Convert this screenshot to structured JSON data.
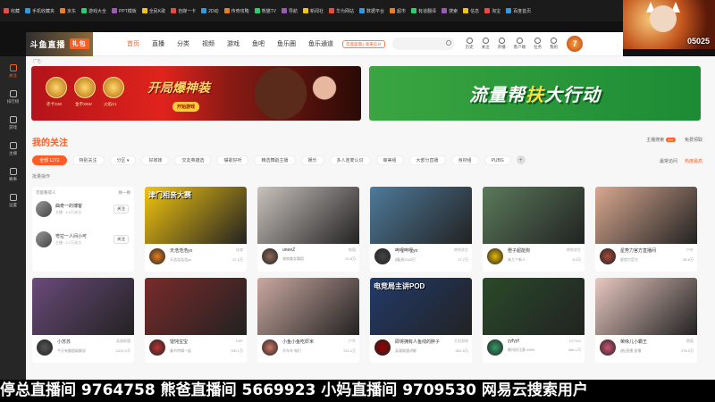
{
  "bookmarks": [
    "收藏",
    "手机收藏夹",
    "京东",
    "游戏大全",
    "PPT模板",
    "全民K歌",
    "自媒一卡",
    "2D动",
    "传奇攻略",
    "熊猫TV",
    "导航",
    "新闻社",
    "华为网站",
    "数据平台",
    "超市",
    "有道翻译",
    "搜索",
    "信息",
    "淘宝",
    "百度首页"
  ],
  "cam": {
    "id": "05025"
  },
  "leftbar": {
    "items": [
      "关注",
      "排行榜",
      "游戏",
      "主播",
      "赛事",
      "设置"
    ]
  },
  "topnav": {
    "logo": "斗鱼直播",
    "logo_badge": "礼包",
    "items": [
      "首页",
      "直播",
      "分类",
      "视频",
      "游戏",
      "鱼吧",
      "鱼乐圈",
      "鱼乐通道"
    ],
    "promo": "年度盛典 | 速来瓜分",
    "icons": [
      "历史",
      "关注",
      "开播",
      "客户端",
      "任务",
      "我的"
    ],
    "avatar": "7"
  },
  "banners": {
    "ad_tag": "广告",
    "left_title": "开局爆神装",
    "left_button": "开始游戏",
    "coins": [
      "赤卡X30",
      "金币X5W",
      "火焰X1"
    ],
    "right_title_a": "流量帮",
    "right_title_hl": "扶",
    "right_title_b": "大行动"
  },
  "follow": {
    "title": "我的关注",
    "right": [
      "主播搜索",
      "免费领取"
    ],
    "right_badge": "99+",
    "filters": [
      "全部 1272",
      "特别关注",
      "分区 ▾",
      "好妹妹",
      "交友英雄选",
      "嘴歌好听",
      "精选舞蹈主播",
      "娱乐",
      "多人连麦认识",
      "审美组",
      "大部分直播",
      "身材组",
      "PUBG"
    ],
    "filter_right": [
      "最常访问",
      "热度最高"
    ],
    "batch": "批量操作"
  },
  "recent": {
    "head_left": "可能看得人",
    "head_right": "换一换",
    "people": [
      {
        "name": "曲奇一的博客",
        "sub": "主播 · 4.0万关注",
        "btn": "关注"
      },
      {
        "name": "粤拉一人间小可",
        "sub": "主播 · 2.1万关注",
        "btn": "关注"
      }
    ]
  },
  "cards": [
    {
      "thumb": "津门相亲大赛",
      "title": "天浩浩浩yo",
      "cat": "体育",
      "sub": "天浩浩浩浩yo",
      "views": "27.2万",
      "bg": "#f1c40f",
      "av": "#e67e22"
    },
    {
      "title": "uneeZ",
      "cat": "颜值",
      "sub": "湖南美女舞蹈",
      "views": "21.8万",
      "bg": "#c9c2bd",
      "av": "#8e6a5a"
    },
    {
      "title": "哔哩哔哩yo",
      "cat": "绝地求生",
      "sub": "[精]抢2042打",
      "views": "17.7万",
      "bg": "#4e7a9a",
      "av": "#444"
    },
    {
      "title": "橙子超能狗",
      "cat": "绝地求生",
      "sub": "来几个新人",
      "views": "8.2万",
      "bg": "#5a7a5a",
      "av": "#e6b800"
    },
    {
      "title": "星势力官方直播间",
      "cat": "户外",
      "sub": "星势力官方",
      "views": "56.6万",
      "bg": "#d8a890",
      "av": "#a64a3a"
    },
    {
      "title": "小苏苏",
      "cat": "英雄联盟",
      "sub": "今天有趣超级解说",
      "views": "1210.4万",
      "bg": "#6a4a7a",
      "av": "#555"
    },
    {
      "title": "馄饨宝宝",
      "cat": "DNF",
      "sub": "春节特辑一起",
      "views": "700.1万",
      "bg": "#7a2a2a",
      "av": "#b33"
    },
    {
      "title": "小鱼小鱼吃虾米",
      "cat": "户外",
      "sub": "开车车 咱们",
      "views": "721.1万",
      "bg": "#caa8a0",
      "av": "#c76"
    },
    {
      "thumb": "电竞局主讲POD",
      "title": "即将拥有人鱼线的胖子",
      "cat": "主机游戏",
      "sub": "英雄联盟讲解",
      "views": "542.5万",
      "bg": "#223a6a",
      "av": "#900"
    },
    {
      "title": "yyfyyf",
      "cat": "DOTA2",
      "sub": "晚间好比赛 9999",
      "views": "466.1万",
      "bg": "#2a4a2a",
      "av": "#396"
    },
    {
      "title": "荣咏儿小霸王",
      "cat": "颜值",
      "sub": "[新]直播 直播",
      "views": "278.3万",
      "bg": "#e8c8c0",
      "av": "#c57"
    }
  ],
  "ticker": "停总直播间 9764758  熊爸直播间 5669923  小妈直播间 9709530  网易云搜索用户"
}
